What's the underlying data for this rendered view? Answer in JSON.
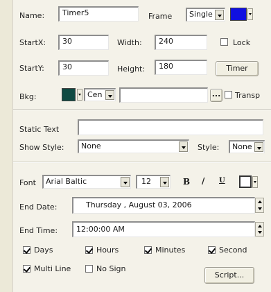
{
  "general": {
    "name_label": "Name:",
    "name_value": "Timer5",
    "frame_label": "Frame",
    "frame_value": "Single",
    "frame_color": "#1010e0",
    "startx_label": "StartX:",
    "startx_value": "30",
    "width_label": "Width:",
    "width_value": "240",
    "lock_label": "Lock",
    "lock_checked": false,
    "starty_label": "StartY:",
    "starty_value": "30",
    "height_label": "Height:",
    "height_value": "180",
    "timer_button": "Timer",
    "bkg_label": "Bkg:",
    "bkg_color": "#0f4a42",
    "bkg_align": "Cen",
    "bkg_image": "",
    "browse_button": "...",
    "transparent_label": "Transp"
  },
  "static": {
    "static_text_label": "Static Text",
    "static_text_value": "",
    "show_style_label": "Show Style:",
    "show_style_value": "None",
    "style_label": "Style:",
    "style_value": "None"
  },
  "font": {
    "font_label": "Font",
    "font_value": "Arial Baltic",
    "size_value": "12",
    "bold": "B",
    "italic": "/",
    "underline": "U",
    "font_color": "#ffffff",
    "end_date_label": "End Date:",
    "end_date_value": "Thursday ,   August   03, 2006",
    "end_time_label": "End Time:",
    "end_time_value": "12:00:00 AM"
  },
  "options": [
    {
      "label": "Days",
      "checked": true
    },
    {
      "label": "Hours",
      "checked": true
    },
    {
      "label": "Minutes",
      "checked": true
    },
    {
      "label": "Second",
      "checked": true
    },
    {
      "label": "Multi Line",
      "checked": true
    },
    {
      "label": "No Sign",
      "checked": false
    }
  ],
  "script_button": "Script..."
}
